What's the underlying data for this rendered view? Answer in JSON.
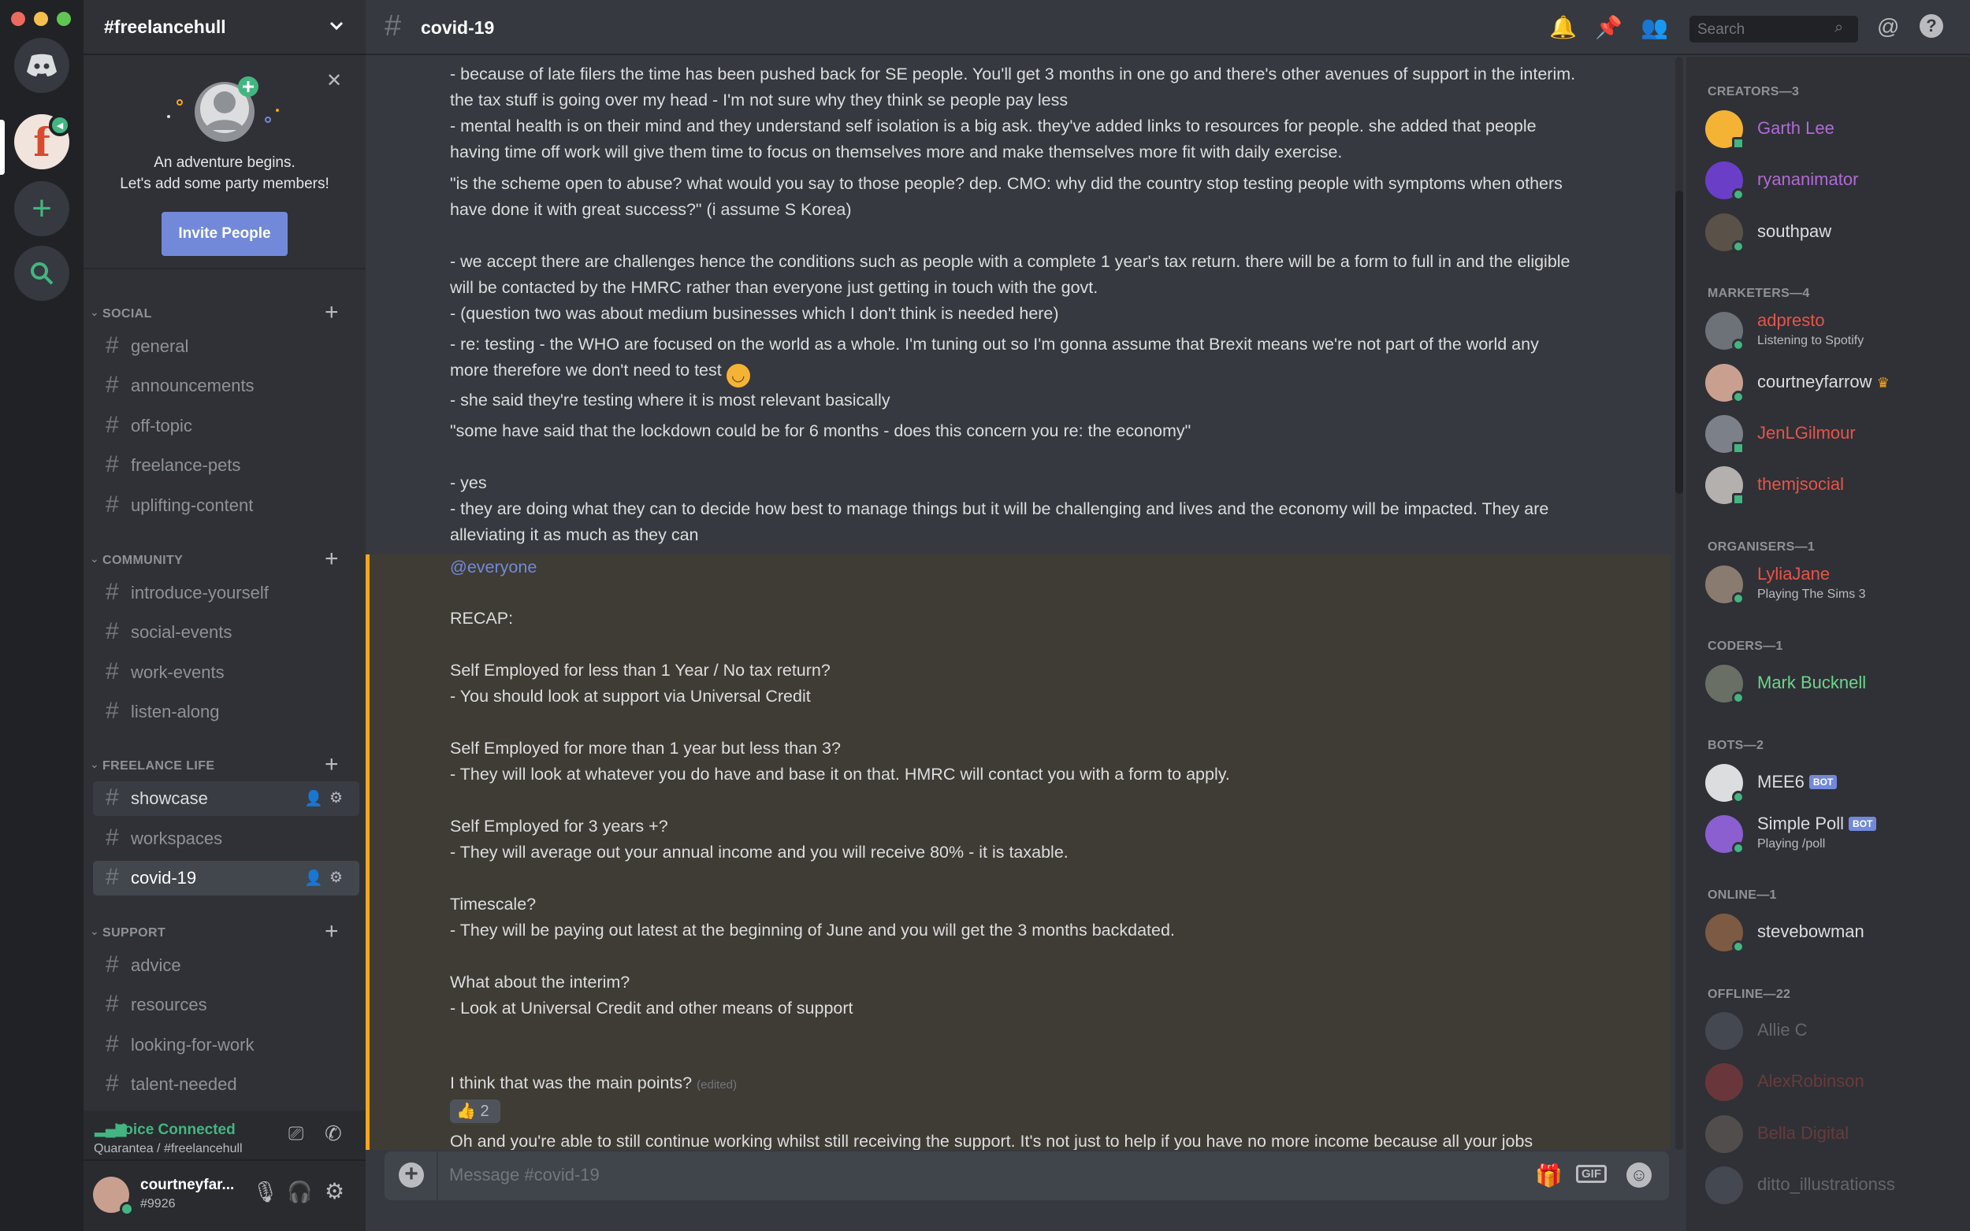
{
  "server": {
    "name": "#freelancehull"
  },
  "invite": {
    "line1": "An adventure begins.",
    "line2": "Let's add some party members!",
    "button": "Invite People"
  },
  "categories": {
    "social": "SOCIAL",
    "community": "COMMUNITY",
    "freelance_life": "FREELANCE LIFE",
    "support": "SUPPORT"
  },
  "channels": {
    "social": [
      "general",
      "announcements",
      "off-topic",
      "freelance-pets",
      "uplifting-content"
    ],
    "community": [
      "introduce-yourself",
      "social-events",
      "work-events",
      "listen-along"
    ],
    "freelance_life": [
      "showcase",
      "workspaces",
      "covid-19"
    ],
    "support": [
      "advice",
      "resources",
      "looking-for-work",
      "talent-needed"
    ]
  },
  "voice": {
    "status": "Voice Connected",
    "channel": "Quarantea / #freelancehull"
  },
  "user": {
    "name": "courtneyfar...",
    "tag": "#9926"
  },
  "topbar": {
    "channel": "covid-19",
    "search_placeholder": "Search"
  },
  "messages": [
    "- because of late filers the time has been pushed back for SE people. You'll get 3 months in one go and there's other avenues of support in the interim.",
    "the tax stuff is going over my head - I'm not sure why they think se people pay less",
    "- mental health is on their mind and they understand self isolation is a big ask. they've added links to resources for people. she added that people\nhaving time off work will give them time to focus on themselves more and make themselves more fit with daily exercise.",
    "\"is the scheme open to abuse? what would you say to those people? dep. CMO: why did the country stop testing people with symptoms when others\nhave done it with great success?\" (i assume S Korea)\n\n- we accept there are challenges hence the conditions such as people with a complete 1 year's tax return. there will be a form to full in and the eligible\nwill be contacted by the HMRC rather than everyone just getting in touch with the govt.\n- (question two was about medium businesses which I don't think is needed here)",
    "- re: testing - the WHO are focused on the world as a whole. I'm tuning out so I'm gonna assume that Brexit means we're not part of the world any\nmore therefore we don't need to test",
    "- she said they're testing where it is most relevant basically",
    "\"some have said that the lockdown could be for 6 months - does this concern you re: the economy\"\n\n- yes\n- they are doing what they can to decide how best to manage things but it will be challenging and lives and the economy will be impacted. They are\nalleviating it as much as they can",
    "@everyone",
    "RECAP:\n\nSelf Employed for less than 1 Year / No tax return?\n- You should look at support via Universal Credit\n\nSelf Employed for more than 1 year but less than 3?\n- They will look at whatever you do have and base it on that. HMRC will contact you with a form to apply.\n\nSelf Employed for 3 years +?\n- They will average out your annual income and you will receive 80% - it is taxable.\n\nTimescale?\n- They will be paying out latest at the beginning of June and you will get the 3 months backdated.\n\nWhat about the interim?\n- Look at Universal Credit and other means of support",
    "I think that was the main points?",
    "Oh and you're able to still continue working whilst still receiving the support. It's not just to help if you have no more income because all your jobs"
  ],
  "edited_label": "(edited)",
  "reaction": {
    "emoji": "👍",
    "count": "2"
  },
  "composer": {
    "placeholder": "Message #covid-19",
    "gif": "GIF"
  },
  "member_groups": {
    "creators": "CREATORS—3",
    "marketers": "MARKETERS—4",
    "organisers": "ORGANISERS—1",
    "coders": "CODERS—1",
    "bots": "BOTS—2",
    "online": "ONLINE—1",
    "offline": "OFFLINE—22"
  },
  "members": {
    "creators": [
      "Garth Lee",
      "ryananimator",
      "southpaw"
    ],
    "marketers": [
      {
        "name": "adpresto",
        "status": "Listening to Spotify"
      },
      {
        "name": "courtneyfarrow"
      },
      {
        "name": "JenLGilmour"
      },
      {
        "name": "themjsocial"
      }
    ],
    "organisers": [
      {
        "name": "LyliaJane",
        "status": "Playing The Sims 3"
      }
    ],
    "coders": [
      "Mark Bucknell"
    ],
    "bots": [
      {
        "name": "MEE6"
      },
      {
        "name": "Simple Poll",
        "status": "Playing /poll"
      }
    ],
    "bot_tag": "BOT",
    "online": [
      "stevebowman"
    ],
    "offline": [
      "Allie C",
      "AlexRobinson",
      "Bella Digital",
      "ditto_illustrationss"
    ]
  },
  "colors": {
    "accent": "#7289da",
    "online": "#43b581",
    "mention": "#faa61a",
    "creator": "#b06ad6",
    "marketer": "#e8534a",
    "coder": "#6fd48c"
  }
}
